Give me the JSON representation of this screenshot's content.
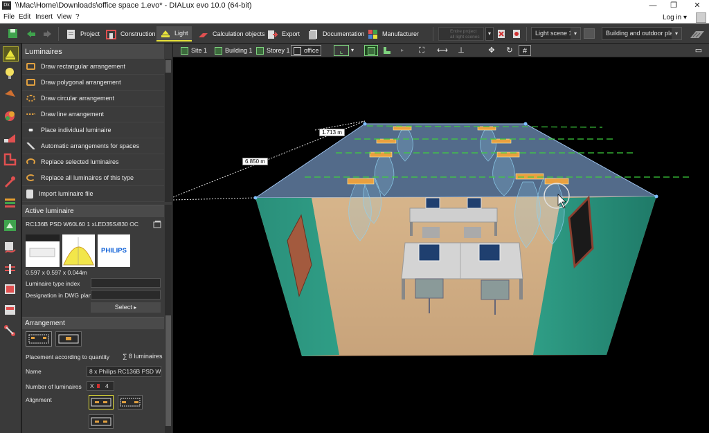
{
  "window": {
    "title": "\\\\Mac\\Home\\Downloads\\office space 1.evo* - DIALux evo 10.0  (64-bit)",
    "app_icon": "Dx",
    "controls": [
      "—",
      "❐",
      "✕"
    ]
  },
  "menu": {
    "items": [
      "File",
      "Edit",
      "Insert",
      "View",
      "?"
    ],
    "login": "Log in ▾"
  },
  "toolbar": {
    "buttons": [
      "Project",
      "Construction",
      "Light",
      "Calculation objects",
      "Export",
      "Documentation",
      "Manufacturer"
    ],
    "active": "Light",
    "entire_project": "Entire project\nall light scenes",
    "light_scene": "Light scene 1",
    "building_select": "Building and outdoor pla..."
  },
  "panel": {
    "luminaires_header": "Luminaires",
    "actions": [
      "Draw rectangular arrangement",
      "Draw polygonal arrangement",
      "Draw circular arrangement",
      "Draw line arrangement",
      "Place individual luminaire",
      "Automatic arrangements for spaces",
      "Replace selected luminaires",
      "Replace all luminaires of this type",
      "Import luminaire file"
    ],
    "active_header": "Active luminaire",
    "luminaire_name": "RC136B PSD W60L60 1 xLED35S/830 OC",
    "brand": "PHILIPS",
    "dimensions": "0.597 x 0.597 x 0.044m",
    "type_index_label": "Luminaire type index",
    "dwg_label": "Designation in DWG plan",
    "select_label": "Select",
    "arrangement_header": "Arrangement",
    "placement_label": "Placement according to quantity",
    "placement_value": "8 luminaires",
    "name_label": "Name",
    "name_value": "8 x Philips RC136B PSD W60L",
    "number_label": "Number of luminaires",
    "number_x": "X",
    "number_y": "4",
    "alignment_label": "Alignment"
  },
  "viewport_toolbar": {
    "crumbs": [
      "Site 1",
      "Building 1",
      "Storey 1",
      "office"
    ]
  },
  "scene": {
    "dim_1": "1.713 m",
    "dim_2": "6.850 m"
  },
  "colors": {
    "accent": "#e8e33a",
    "wall": "#2f9e86",
    "ceiling": "#6f8fb8",
    "floor": "#c8a27a"
  }
}
